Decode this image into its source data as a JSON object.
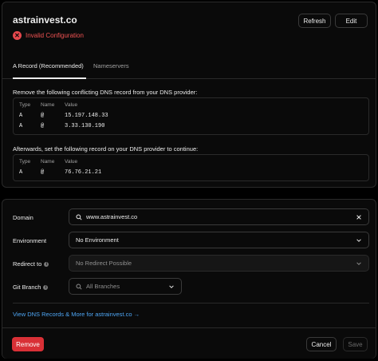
{
  "domain": {
    "name": "astrainvest.co",
    "status": "Invalid Configuration",
    "status_color": "#e5484d"
  },
  "actions": {
    "refresh": "Refresh",
    "edit": "Edit"
  },
  "tabs": [
    {
      "label": "A Record (Recommended)",
      "active": true
    },
    {
      "label": "Nameservers",
      "active": false
    }
  ],
  "conflicting": {
    "instruction": "Remove the following conflicting DNS record from your DNS provider:",
    "headers": [
      "Type",
      "Name",
      "Value"
    ],
    "rows": [
      [
        "A",
        "@",
        "15.197.148.33"
      ],
      [
        "A",
        "@",
        "3.33.130.190"
      ]
    ]
  },
  "required": {
    "instruction": "Afterwards, set the following record on your DNS provider to continue:",
    "headers": [
      "Type",
      "Name",
      "Value"
    ],
    "rows": [
      [
        "A",
        "@",
        "76.76.21.21"
      ]
    ]
  },
  "form": {
    "domain_label": "Domain",
    "domain_value": "www.astrainvest.co",
    "environment_label": "Environment",
    "environment_value": "No Environment",
    "redirect_label": "Redirect to",
    "redirect_value": "No Redirect Possible",
    "git_branch_label": "Git Branch",
    "git_branch_placeholder": "All Branches",
    "info_glyph": "i"
  },
  "link": "View DNS Records & More for astrainvest.co →",
  "footer": {
    "remove": "Remove",
    "cancel": "Cancel",
    "save": "Save"
  },
  "colors": {
    "accent_link": "#4ea6f5",
    "danger": "#d93036"
  }
}
